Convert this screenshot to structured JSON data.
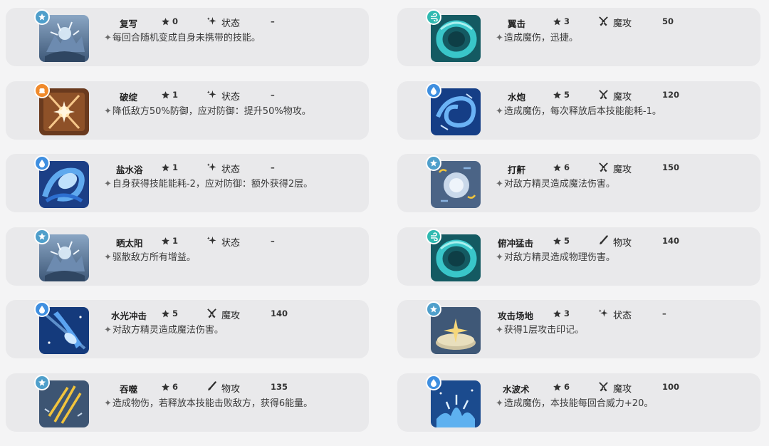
{
  "left_column": [
    {
      "name": "复写",
      "cost": "0",
      "type": "状态",
      "type_icon": "sparkle-icon",
      "power": "–",
      "description": "每回合随机变成自身未携带的技能。",
      "element": "normal",
      "art": "normal"
    },
    {
      "name": "破绽",
      "cost": "1",
      "type": "状态",
      "type_icon": "sparkle-icon",
      "power": "–",
      "description": "降低敌方50%防御，应对防御：提升50%物攻。",
      "element": "fighting",
      "art": "crack"
    },
    {
      "name": "盐水浴",
      "cost": "1",
      "type": "状态",
      "type_icon": "sparkle-icon",
      "power": "–",
      "description": "自身获得技能能耗-2，应对防御：额外获得2层。",
      "element": "water",
      "art": "water-swirl"
    },
    {
      "name": "晒太阳",
      "cost": "1",
      "type": "状态",
      "type_icon": "sparkle-icon",
      "power": "–",
      "description": "驱散敌方所有增益。",
      "element": "normal",
      "art": "normal"
    },
    {
      "name": "水光冲击",
      "cost": "5",
      "type": "魔攻",
      "type_icon": "crossed-swords-icon",
      "power": "140",
      "description": "对敌方精灵造成魔法伤害。",
      "element": "water",
      "art": "water-beam"
    },
    {
      "name": "吞噬",
      "cost": "6",
      "type": "物攻",
      "type_icon": "brush-icon",
      "power": "135",
      "description": "造成物伤，若释放本技能击败敌方，获得6能量。",
      "element": "normal",
      "art": "slash"
    }
  ],
  "right_column": [
    {
      "name": "翼击",
      "cost": "3",
      "type": "魔攻",
      "type_icon": "crossed-swords-icon",
      "power": "50",
      "description": "造成魔伤，迅捷。",
      "element": "wind",
      "art": "teal-ring"
    },
    {
      "name": "水炮",
      "cost": "5",
      "type": "魔攻",
      "type_icon": "crossed-swords-icon",
      "power": "120",
      "description": "造成魔伤，每次释放后本技能能耗-1。",
      "element": "water",
      "art": "water-spiral"
    },
    {
      "name": "打鼾",
      "cost": "6",
      "type": "魔攻",
      "type_icon": "crossed-swords-icon",
      "power": "150",
      "description": "对敌方精灵造成魔法伤害。",
      "element": "normal",
      "art": "snore"
    },
    {
      "name": "俯冲猛击",
      "cost": "5",
      "type": "物攻",
      "type_icon": "brush-icon",
      "power": "140",
      "description": "对敌方精灵造成物理伤害。",
      "element": "wind",
      "art": "teal-ring"
    },
    {
      "name": "攻击场地",
      "cost": "3",
      "type": "状态",
      "type_icon": "sparkle-icon",
      "power": "–",
      "description": "获得1层攻击印记。",
      "element": "normal",
      "art": "field"
    },
    {
      "name": "水波术",
      "cost": "6",
      "type": "魔攻",
      "type_icon": "crossed-swords-icon",
      "power": "100",
      "description": "造成魔伤，本技能每回合威力+20。",
      "element": "water",
      "art": "splash"
    }
  ],
  "colors": {
    "card_bg": "#e9e9eb",
    "normal_badge": "#4f9fcb",
    "water_badge": "#3f8fe0",
    "fighting_badge": "#f08a2c",
    "wind_badge": "#2fb9b0"
  }
}
